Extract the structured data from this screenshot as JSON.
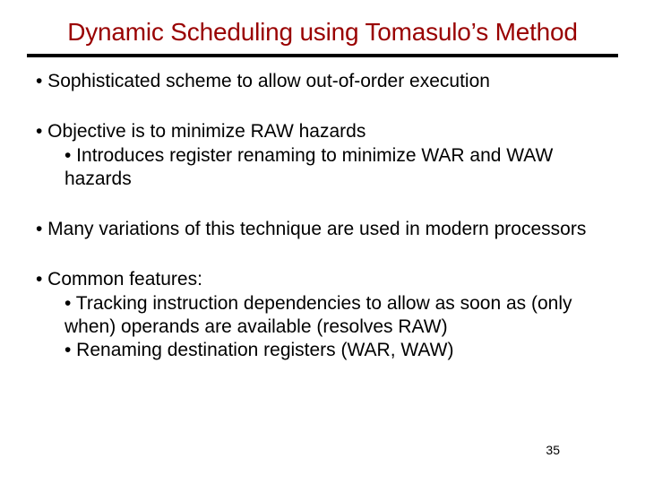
{
  "title": "Dynamic Scheduling using Tomasulo’s Method",
  "bullets": {
    "b1": "• Sophisticated scheme to allow out-of-order execution",
    "b2": "• Objective is to minimize RAW hazards",
    "b2a": "•  Introduces register renaming to minimize WAR and WAW hazards",
    "b3": "• Many variations of this technique are used in modern processors",
    "b4": "• Common features:",
    "b4a": "•  Tracking instruction dependencies to allow as soon as (only when) operands are available (resolves RAW)",
    "b4b": "•  Renaming destination registers (WAR, WAW)"
  },
  "page_number": "35"
}
